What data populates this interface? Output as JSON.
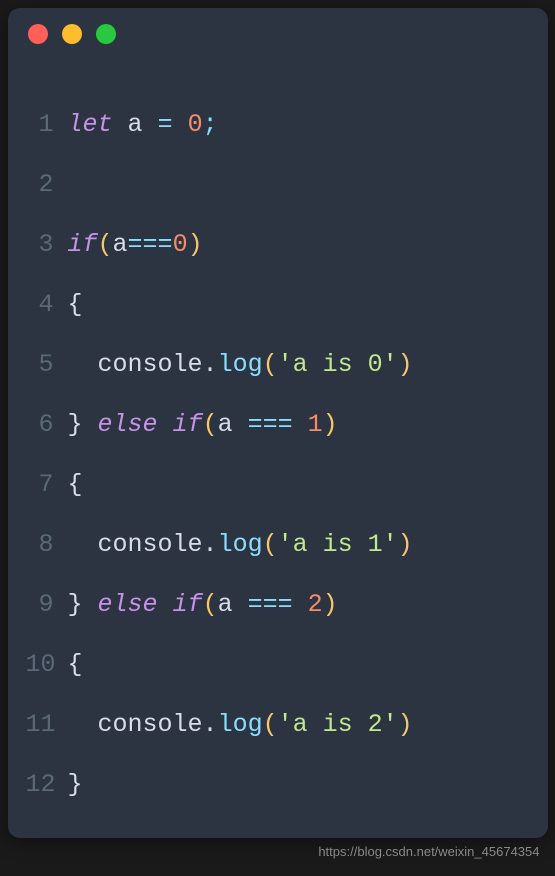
{
  "editor": {
    "titlebar": {
      "lights": [
        "red",
        "yellow",
        "green"
      ]
    },
    "lines": [
      {
        "num": "1"
      },
      {
        "num": "2"
      },
      {
        "num": "3"
      },
      {
        "num": "4"
      },
      {
        "num": "5"
      },
      {
        "num": "6"
      },
      {
        "num": "7"
      },
      {
        "num": "8"
      },
      {
        "num": "9"
      },
      {
        "num": "10"
      },
      {
        "num": "11"
      },
      {
        "num": "12"
      }
    ],
    "code": {
      "line1": {
        "let": "let",
        "a": "a",
        "eq": "=",
        "zero": "0",
        "semi": ";"
      },
      "line2": {
        "empty": ""
      },
      "line3": {
        "if": "if",
        "lp": "(",
        "a": "a",
        "eqeq": "===",
        "zero": "0",
        "rp": ")"
      },
      "line4": {
        "brace": "{"
      },
      "line5": {
        "indent": "  ",
        "console": "console",
        "dot": ".",
        "log": "log",
        "lp": "(",
        "str": "'a is 0'",
        "rp": ")"
      },
      "line6": {
        "brace": "}",
        "sp": " ",
        "else": "else",
        "sp2": " ",
        "if": "if",
        "lp": "(",
        "a": "a",
        "sp3": " ",
        "eqeq": "===",
        "sp4": " ",
        "one": "1",
        "rp": ")"
      },
      "line7": {
        "brace": "{"
      },
      "line8": {
        "indent": "  ",
        "console": "console",
        "dot": ".",
        "log": "log",
        "lp": "(",
        "str": "'a is 1'",
        "rp": ")"
      },
      "line9": {
        "brace": "}",
        "sp": " ",
        "else": "else",
        "sp2": " ",
        "if": "if",
        "lp": "(",
        "a": "a",
        "sp3": " ",
        "eqeq": "===",
        "sp4": " ",
        "two": "2",
        "rp": ")"
      },
      "line10": {
        "brace": "{"
      },
      "line11": {
        "indent": "  ",
        "console": "console",
        "dot": ".",
        "log": "log",
        "lp": "(",
        "str": "'a is 2'",
        "rp": ")"
      },
      "line12": {
        "brace": "}"
      }
    }
  },
  "watermark": "https://blog.csdn.net/weixin_45674354"
}
